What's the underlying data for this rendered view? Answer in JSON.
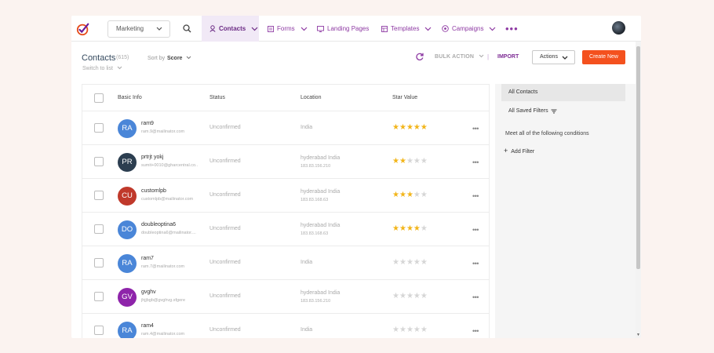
{
  "nav": {
    "workspace": "Marketing",
    "items": [
      {
        "label": "Contacts",
        "icon": "contacts-icon",
        "active": true
      },
      {
        "label": "Forms",
        "icon": "forms-icon"
      },
      {
        "label": "Landing Pages",
        "icon": "landing-pages-icon"
      },
      {
        "label": "Templates",
        "icon": "templates-icon"
      },
      {
        "label": "Campaigns",
        "icon": "campaigns-icon"
      }
    ],
    "more": "•••"
  },
  "header": {
    "title": "Contacts",
    "count": "(615)",
    "sort_label": "Sort by",
    "sort_value": "Score",
    "switch_list": "Switch to list",
    "bulk_action": "BULK ACTION",
    "separator": "|",
    "import": "IMPORT",
    "actions": "Actions",
    "create_new": "Create New"
  },
  "table": {
    "columns": [
      "Basic Info",
      "Status",
      "Location",
      "Star Value"
    ],
    "rows": [
      {
        "initials": "RA",
        "color": "#4a86d8",
        "name": "ram9",
        "email": "ram.9@mailinator.com",
        "status": "Unconfirmed",
        "location": "India",
        "ip": "",
        "stars": 5
      },
      {
        "initials": "PR",
        "color": "#2c3e50",
        "name": "prtrjt yokj",
        "email": "sumit+0010@gharcentral.co..",
        "status": "Unconfirmed",
        "location": "hyderabad India",
        "ip": "183.83.156.210",
        "stars": 2
      },
      {
        "initials": "CU",
        "color": "#c0392b",
        "name": "customlpb",
        "email": "customlpb@mailinator.com",
        "status": "Unconfirmed",
        "location": "hyderabad India",
        "ip": "183.83.168.63",
        "stars": 3
      },
      {
        "initials": "DO",
        "color": "#4a86d8",
        "name": "doubleoptina6",
        "email": "doubleoptina6@mailinator....",
        "status": "Unconfirmed",
        "location": "hyderabad India",
        "ip": "183.83.168.63",
        "stars": 4
      },
      {
        "initials": "RA",
        "color": "#4a86d8",
        "name": "ram7",
        "email": "ram.7@mailinator.com",
        "status": "Unconfirmed",
        "location": "India",
        "ip": "",
        "stars": 0
      },
      {
        "initials": "GV",
        "color": "#8e24aa",
        "name": "gvghv",
        "email": "jhjjbgb@gvghvg.sfgere",
        "status": "Unconfirmed",
        "location": "hyderabad India",
        "ip": "183.83.156.210",
        "stars": 0
      },
      {
        "initials": "RA",
        "color": "#4a86d8",
        "name": "ram4",
        "email": "ram.4@mailinator.com",
        "status": "Unconfirmed",
        "location": "India",
        "ip": "",
        "stars": 0
      }
    ]
  },
  "filters": {
    "all_contacts": "All Contacts",
    "all_saved": "All Saved Filters",
    "conditions": "Meet all of the following conditions",
    "add_filter": "Add Filter"
  },
  "colors": {
    "brand_purple": "#8e3aa3",
    "accent_orange": "#f4511e",
    "star_gold": "#f2b51a"
  }
}
